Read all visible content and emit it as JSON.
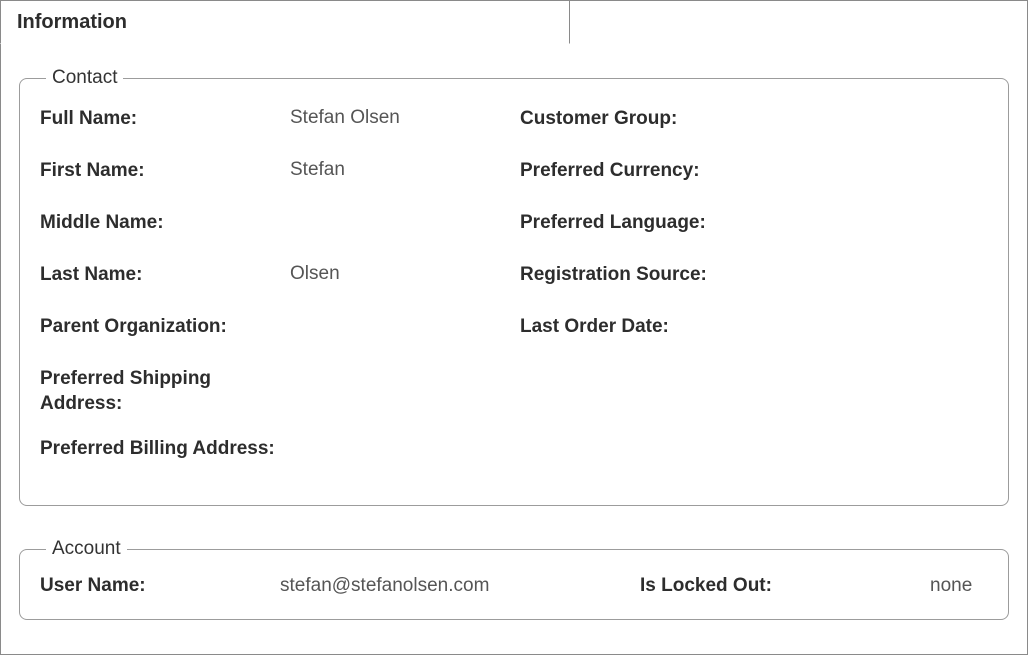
{
  "tab": {
    "label": "Information"
  },
  "contact": {
    "legend": "Contact",
    "full_name_label": "Full Name:",
    "full_name_value": "Stefan Olsen",
    "first_name_label": "First Name:",
    "first_name_value": "Stefan",
    "middle_name_label": "Middle Name:",
    "middle_name_value": "",
    "last_name_label": "Last Name:",
    "last_name_value": "Olsen",
    "parent_org_label": "Parent Organization:",
    "parent_org_value": "",
    "pref_shipping_label": "Preferred Shipping Address:",
    "pref_shipping_value": "",
    "pref_billing_label": "Preferred Billing Address:",
    "pref_billing_value": "",
    "customer_group_label": "Customer Group:",
    "customer_group_value": "",
    "pref_currency_label": "Preferred Currency:",
    "pref_currency_value": "",
    "pref_language_label": "Preferred Language:",
    "pref_language_value": "",
    "reg_source_label": "Registration Source:",
    "reg_source_value": "",
    "last_order_label": "Last Order Date:",
    "last_order_value": ""
  },
  "account": {
    "legend": "Account",
    "user_name_label": "User Name:",
    "user_name_value": "stefan@stefanolsen.com",
    "locked_out_label": "Is Locked Out:",
    "locked_out_value": "none"
  }
}
